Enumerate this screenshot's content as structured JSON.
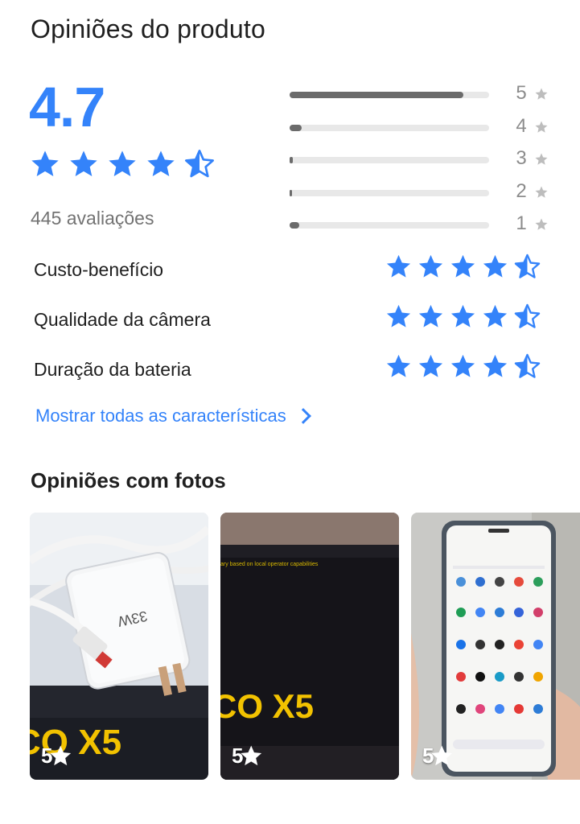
{
  "header": {
    "title": "Opiniões do produto"
  },
  "summary": {
    "score": "4.7",
    "rating_value": 4.7,
    "count_label": "445 avaliações",
    "star_color": "#3483fa"
  },
  "distribution": [
    {
      "stars": "5",
      "fraction": 0.87
    },
    {
      "stars": "4",
      "fraction": 0.06
    },
    {
      "stars": "3",
      "fraction": 0.015
    },
    {
      "stars": "2",
      "fraction": 0.008
    },
    {
      "stars": "1",
      "fraction": 0.05
    }
  ],
  "features": [
    {
      "label": "Custo-benefício",
      "rating": 4.5
    },
    {
      "label": "Qualidade da câmera",
      "rating": 4.5
    },
    {
      "label": "Duração da bateria",
      "rating": 4.5
    }
  ],
  "show_all_link": "Mostrar todas as características",
  "photos_section": {
    "title": "Opiniões com fotos",
    "photos": [
      {
        "rating": "5",
        "box_text": "CO X5",
        "charger_label": "33W"
      },
      {
        "rating": "5",
        "box_text": "CO X5",
        "box_small_text": "ary based on local operator capabilities"
      },
      {
        "rating": "5"
      }
    ]
  }
}
